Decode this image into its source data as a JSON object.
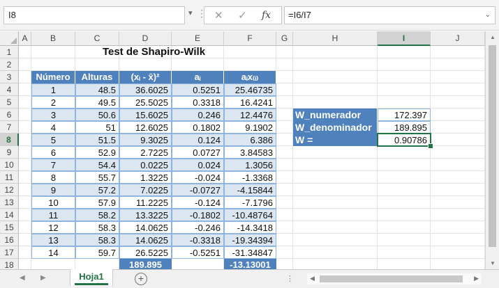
{
  "formula_bar": {
    "name_box": "I8",
    "cancel_icon": "✕",
    "enter_icon": "✓",
    "fx_label": "fx",
    "formula": "=I6/I7"
  },
  "columns": [
    "A",
    "B",
    "C",
    "D",
    "E",
    "F",
    "G",
    "H",
    "I",
    "J"
  ],
  "selected_column": "I",
  "rows": [
    "1",
    "2",
    "3",
    "4",
    "5",
    "6",
    "7",
    "8",
    "9",
    "10",
    "11",
    "12",
    "13",
    "14",
    "15",
    "16",
    "17",
    "18"
  ],
  "selected_row": "8",
  "title": "Test de Shapiro-Wilk",
  "table": {
    "headers": [
      "Número",
      "Alturas",
      "(xᵢ - x̄)²",
      "aᵢ",
      "aᵢx₍ᵢ₎"
    ],
    "rows": [
      [
        "1",
        "48.5",
        "36.6025",
        "0.5251",
        "25.46735"
      ],
      [
        "2",
        "49.5",
        "25.5025",
        "0.3318",
        "16.4241"
      ],
      [
        "3",
        "50.6",
        "15.6025",
        "0.246",
        "12.4476"
      ],
      [
        "4",
        "51",
        "12.6025",
        "0.1802",
        "9.1902"
      ],
      [
        "5",
        "51.5",
        "9.3025",
        "0.124",
        "6.386"
      ],
      [
        "6",
        "52.9",
        "2.7225",
        "0.0727",
        "3.84583"
      ],
      [
        "7",
        "54.4",
        "0.0225",
        "0.024",
        "1.3056"
      ],
      [
        "8",
        "55.7",
        "1.3225",
        "-0.024",
        "-1.3368"
      ],
      [
        "9",
        "57.2",
        "7.0225",
        "-0.0727",
        "-4.15844"
      ],
      [
        "10",
        "57.9",
        "11.2225",
        "-0.124",
        "-7.1796"
      ],
      [
        "11",
        "58.2",
        "13.3225",
        "-0.1802",
        "-10.48764"
      ],
      [
        "12",
        "58.3",
        "14.0625",
        "-0.246",
        "-14.3418"
      ],
      [
        "13",
        "58.3",
        "14.0625",
        "-0.3318",
        "-19.34394"
      ],
      [
        "14",
        "59.7",
        "26.5225",
        "-0.5251",
        "-31.34847"
      ]
    ],
    "total_d": "189.895",
    "total_f": "-13.13001"
  },
  "summary": [
    {
      "label": "W_numerador",
      "value": "172.397"
    },
    {
      "label": "W_denominador",
      "value": "189.895"
    },
    {
      "label": "W =",
      "value": "0.90786"
    }
  ],
  "sheet_tab": "Hoja1",
  "add_sheet": "+",
  "colors": {
    "header_blue": "#4f81bd",
    "band_blue": "#dce6f1",
    "excel_green": "#217346"
  }
}
